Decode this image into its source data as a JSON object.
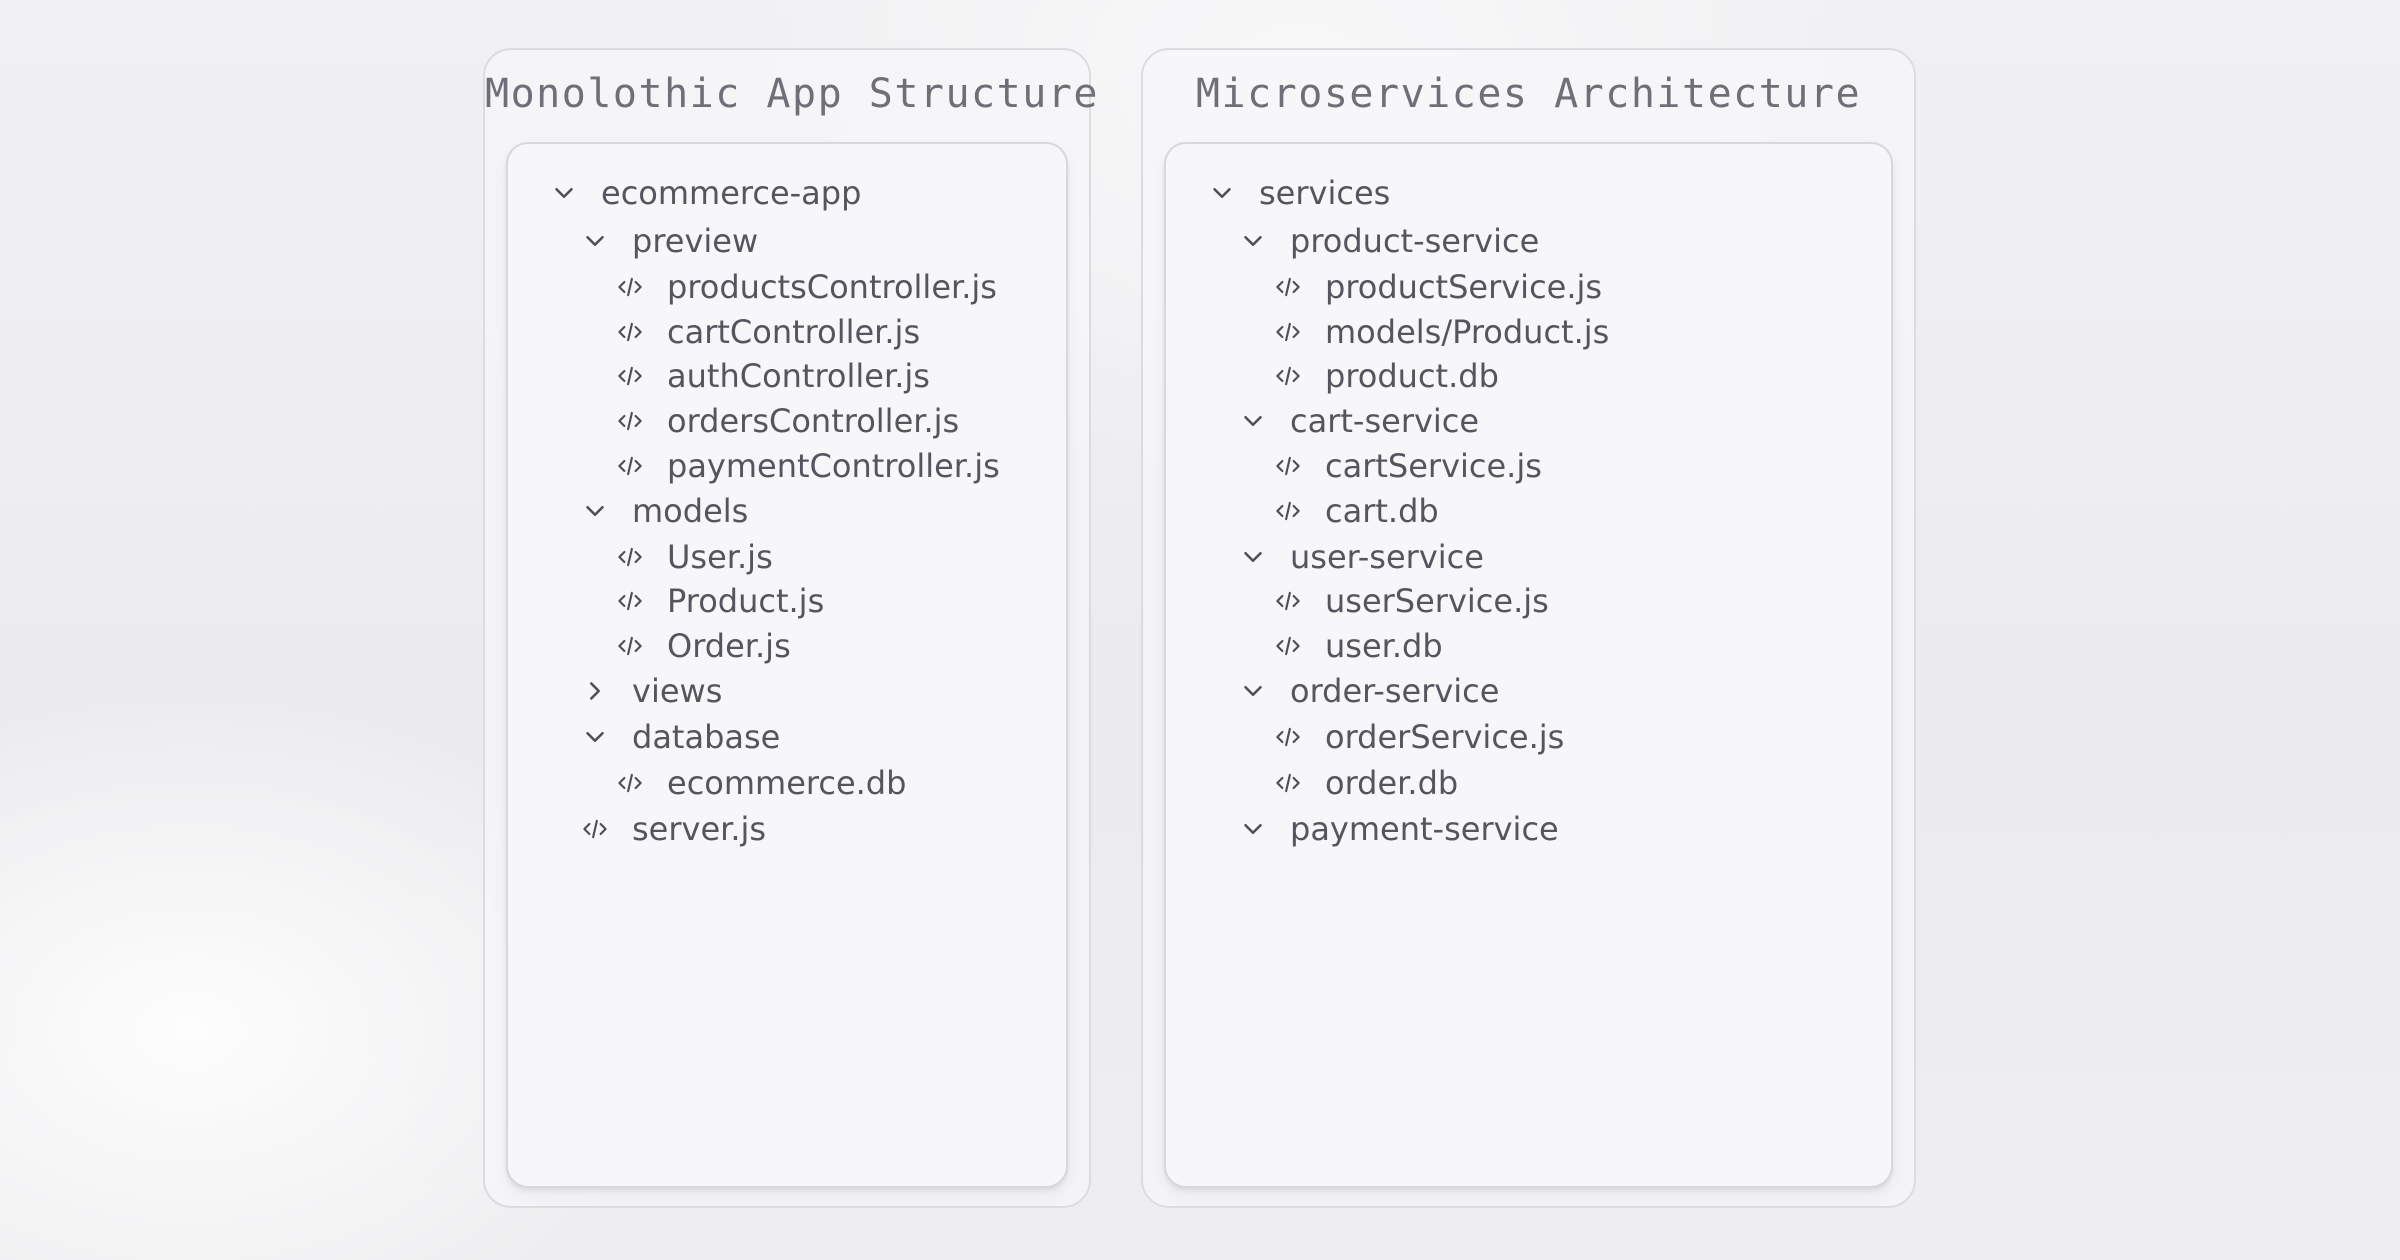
{
  "monolith": {
    "title": "Monolothic App Structure",
    "tree": [
      {
        "depth": 0,
        "kind": "folder",
        "expanded": true,
        "label": "ecommerce-app",
        "icon": "chevron-down-icon"
      },
      {
        "depth": 1,
        "kind": "folder",
        "expanded": true,
        "label": "preview",
        "icon": "chevron-down-icon"
      },
      {
        "depth": 2,
        "kind": "file",
        "label": "productsController.js",
        "icon": "code-icon"
      },
      {
        "depth": 2,
        "kind": "file",
        "label": "cartController.js",
        "icon": "code-icon"
      },
      {
        "depth": 2,
        "kind": "file",
        "label": "authController.js",
        "icon": "code-icon"
      },
      {
        "depth": 2,
        "kind": "file",
        "label": "ordersController.js",
        "icon": "code-icon"
      },
      {
        "depth": 2,
        "kind": "file",
        "label": "paymentController.js",
        "icon": "code-icon"
      },
      {
        "depth": 1,
        "kind": "folder",
        "expanded": true,
        "label": "models",
        "icon": "chevron-down-icon"
      },
      {
        "depth": 2,
        "kind": "file",
        "label": "User.js",
        "icon": "code-icon"
      },
      {
        "depth": 2,
        "kind": "file",
        "label": "Product.js",
        "icon": "code-icon"
      },
      {
        "depth": 2,
        "kind": "file",
        "label": "Order.js",
        "icon": "code-icon"
      },
      {
        "depth": 1,
        "kind": "folder",
        "expanded": false,
        "label": "views",
        "icon": "chevron-right-icon"
      },
      {
        "depth": 1,
        "kind": "folder",
        "expanded": true,
        "label": "database",
        "icon": "chevron-down-icon"
      },
      {
        "depth": 2,
        "kind": "file",
        "label": "ecommerce.db",
        "icon": "code-icon"
      },
      {
        "depth": 1,
        "kind": "file",
        "label": "server.js",
        "icon": "code-icon"
      }
    ]
  },
  "microservices": {
    "title": "Microservices Architecture",
    "tree": [
      {
        "depth": 0,
        "kind": "folder",
        "expanded": true,
        "label": "services",
        "icon": "chevron-down-icon"
      },
      {
        "depth": 1,
        "kind": "folder",
        "expanded": true,
        "label": "product-service",
        "icon": "chevron-down-icon"
      },
      {
        "depth": 2,
        "kind": "file",
        "label": "productService.js",
        "icon": "code-icon"
      },
      {
        "depth": 2,
        "kind": "file",
        "label": "models/Product.js",
        "icon": "code-icon"
      },
      {
        "depth": 2,
        "kind": "file",
        "label": "product.db",
        "icon": "code-icon"
      },
      {
        "depth": 1,
        "kind": "folder",
        "expanded": true,
        "label": "cart-service",
        "icon": "chevron-down-icon"
      },
      {
        "depth": 2,
        "kind": "file",
        "label": "cartService.js",
        "icon": "code-icon"
      },
      {
        "depth": 2,
        "kind": "file",
        "label": "cart.db",
        "icon": "code-icon"
      },
      {
        "depth": 1,
        "kind": "folder",
        "expanded": true,
        "label": "user-service",
        "icon": "chevron-down-icon"
      },
      {
        "depth": 2,
        "kind": "file",
        "label": "userService.js",
        "icon": "code-icon"
      },
      {
        "depth": 2,
        "kind": "file",
        "label": "user.db",
        "icon": "code-icon"
      },
      {
        "depth": 1,
        "kind": "folder",
        "expanded": true,
        "label": "order-service",
        "icon": "chevron-down-icon"
      },
      {
        "depth": 2,
        "kind": "file",
        "label": "orderService.js",
        "icon": "code-icon"
      },
      {
        "depth": 2,
        "kind": "file",
        "label": "order.db",
        "icon": "code-icon"
      },
      {
        "depth": 1,
        "kind": "folder",
        "expanded": true,
        "label": "payment-service",
        "icon": "chevron-down-icon"
      }
    ]
  },
  "colors": {
    "text": "#55555e",
    "title": "#6f6f78",
    "icon": "#4e4e56",
    "border": "#d7d7dc",
    "card": "#f7f7f9"
  }
}
